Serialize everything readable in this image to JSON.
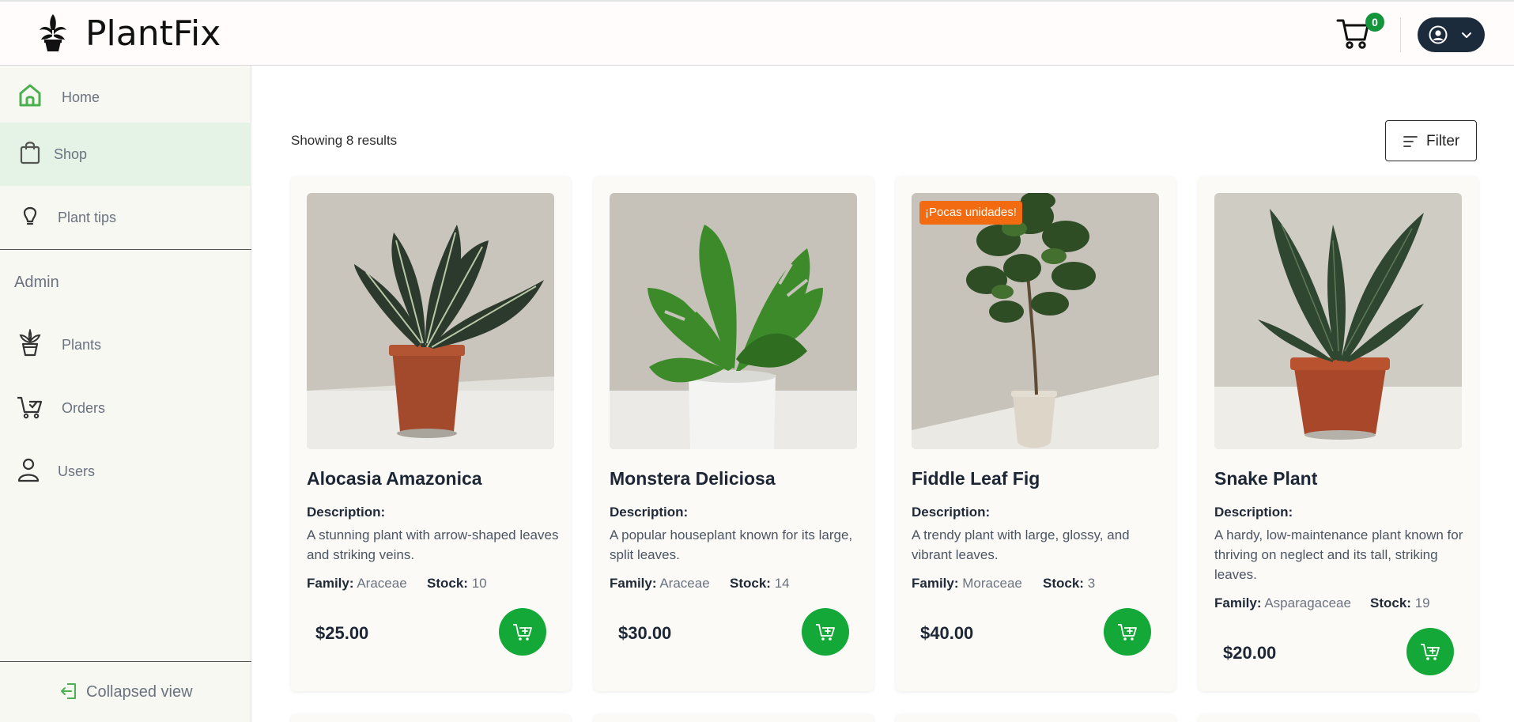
{
  "header": {
    "brand": "PlantFix",
    "cart_count": "0",
    "logo_icon": "potted-plant-icon",
    "cart_icon": "shopping-cart-icon",
    "user_icon": "user-circle-icon"
  },
  "sidebar": {
    "items": [
      {
        "label": "Home",
        "icon": "home-icon"
      },
      {
        "label": "Shop",
        "icon": "shopping-bag-icon"
      },
      {
        "label": "Plant tips",
        "icon": "lightbulb-icon"
      }
    ],
    "admin_heading": "Admin",
    "admin_items": [
      {
        "label": "Plants",
        "icon": "plant-icon"
      },
      {
        "label": "Orders",
        "icon": "cart-check-icon"
      },
      {
        "label": "Users",
        "icon": "user-icon"
      }
    ],
    "collapse_label": "Collapsed view"
  },
  "main": {
    "results_text": "Showing 8 results",
    "filter_label": "Filter",
    "description_label": "Description:",
    "family_label": "Family:",
    "stock_label": "Stock:",
    "products": [
      {
        "name": "Alocasia Amazonica",
        "description": "A stunning plant with arrow-shaped leaves and striking veins.",
        "family": "Araceae",
        "stock": "10",
        "price": "$25.00",
        "badge": ""
      },
      {
        "name": "Monstera Deliciosa",
        "description": "A popular houseplant known for its large, split leaves.",
        "family": "Araceae",
        "stock": "14",
        "price": "$30.00",
        "badge": ""
      },
      {
        "name": "Fiddle Leaf Fig",
        "description": "A trendy plant with large, glossy, and vibrant leaves.",
        "family": "Moraceae",
        "stock": "3",
        "price": "$40.00",
        "badge": "¡Pocas unidades!"
      },
      {
        "name": "Snake Plant",
        "description": "A hardy, low-maintenance plant known for thriving on neglect and its tall, striking leaves.",
        "family": "Asparagaceae",
        "stock": "19",
        "price": "$20.00",
        "badge": ""
      }
    ]
  },
  "colors": {
    "accent_green": "#14a838",
    "active_nav_bg": "#e5f3e7",
    "badge_orange": "#f36b10",
    "user_button": "#1c2b3c"
  }
}
